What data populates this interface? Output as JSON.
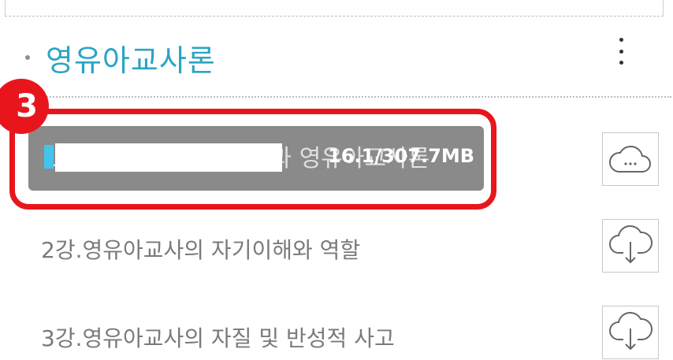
{
  "section": {
    "title": "영유아교사론"
  },
  "step_badge": "3",
  "download": {
    "title_partial": "1강.영유아교사의 개념과 영유아교사론",
    "progress_text": "16.1/307.7MB",
    "progress_fraction": 0.052,
    "status_icon": "cloud-dots-icon",
    "accent_color": "#44c3ec",
    "highlight_color": "#e8161c"
  },
  "lectures": [
    {
      "label": "2강.영유아교사의 자기이해와 역할",
      "icon": "cloud-download-icon"
    },
    {
      "label": "3강.영유아교사의 자질 및 반성적 사고",
      "icon": "cloud-download-icon"
    }
  ]
}
